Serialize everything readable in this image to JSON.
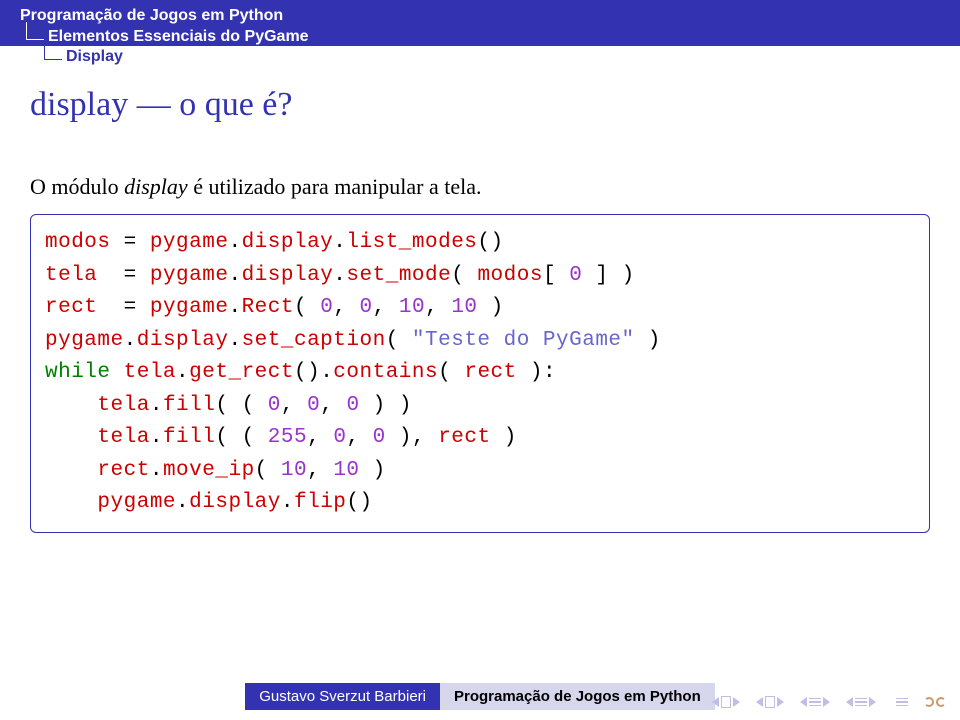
{
  "breadcrumb": {
    "level1": "Programação de Jogos em Python",
    "level2": "Elementos Essenciais do PyGame",
    "level3": "Display"
  },
  "title": "display — o que é?",
  "intro": {
    "pre": "O módulo ",
    "ital": "display",
    "post": " é utilizado para manipular a tela."
  },
  "code": {
    "l1": {
      "a": "modos",
      "eq": " = ",
      "b": "pygame",
      "dot1": ".",
      "c": "display",
      "dot2": ".",
      "d": "list_modes",
      "e": "()"
    },
    "l2": {
      "a": "tela",
      "eq": "  = ",
      "b": "pygame",
      "dot1": ".",
      "c": "display",
      "dot2": ".",
      "d": "set_mode",
      "e": "( ",
      "f": "modos",
      "g": "[ ",
      "h": "0",
      "i": " ] )"
    },
    "l3": {
      "a": "rect",
      "eq": "  = ",
      "b": "pygame",
      "dot1": ".",
      "c": "Rect",
      "d": "( ",
      "e": "0",
      "f": ", ",
      "g": "0",
      "h": ", ",
      "i": "10",
      "j": ", ",
      "k": "10",
      "l": " )"
    },
    "l4": {
      "a": "pygame",
      "dot1": ".",
      "b": "display",
      "dot2": ".",
      "c": "set_caption",
      "d": "( ",
      "e": "\"Teste do PyGame\"",
      "f": " )"
    },
    "l5": {
      "a": "while",
      "sp": " ",
      "b": "tela",
      "dot1": ".",
      "c": "get_rect",
      "d": "().",
      "e": "contains",
      "f": "( ",
      "g": "rect",
      "h": " ):"
    },
    "l6": {
      "pad": "    ",
      "a": "tela",
      "dot1": ".",
      "b": "fill",
      "c": "( ( ",
      "d": "0",
      "e": ", ",
      "f": "0",
      "g": ", ",
      "h": "0",
      "i": " ) )"
    },
    "l7": {
      "pad": "    ",
      "a": "tela",
      "dot1": ".",
      "b": "fill",
      "c": "( ( ",
      "d": "255",
      "e": ", ",
      "f": "0",
      "g": ", ",
      "h": "0",
      "i": " ), ",
      "j": "rect",
      "k": " )"
    },
    "l8": {
      "pad": "    ",
      "a": "rect",
      "dot1": ".",
      "b": "move_ip",
      "c": "( ",
      "d": "10",
      "e": ", ",
      "f": "10",
      "g": " )"
    },
    "l9": {
      "pad": "    ",
      "a": "pygame",
      "dot1": ".",
      "b": "display",
      "dot2": ".",
      "c": "flip",
      "d": "()"
    }
  },
  "footer": {
    "author": "Gustavo Sverzut Barbieri",
    "title": "Programação de Jogos em Python"
  }
}
